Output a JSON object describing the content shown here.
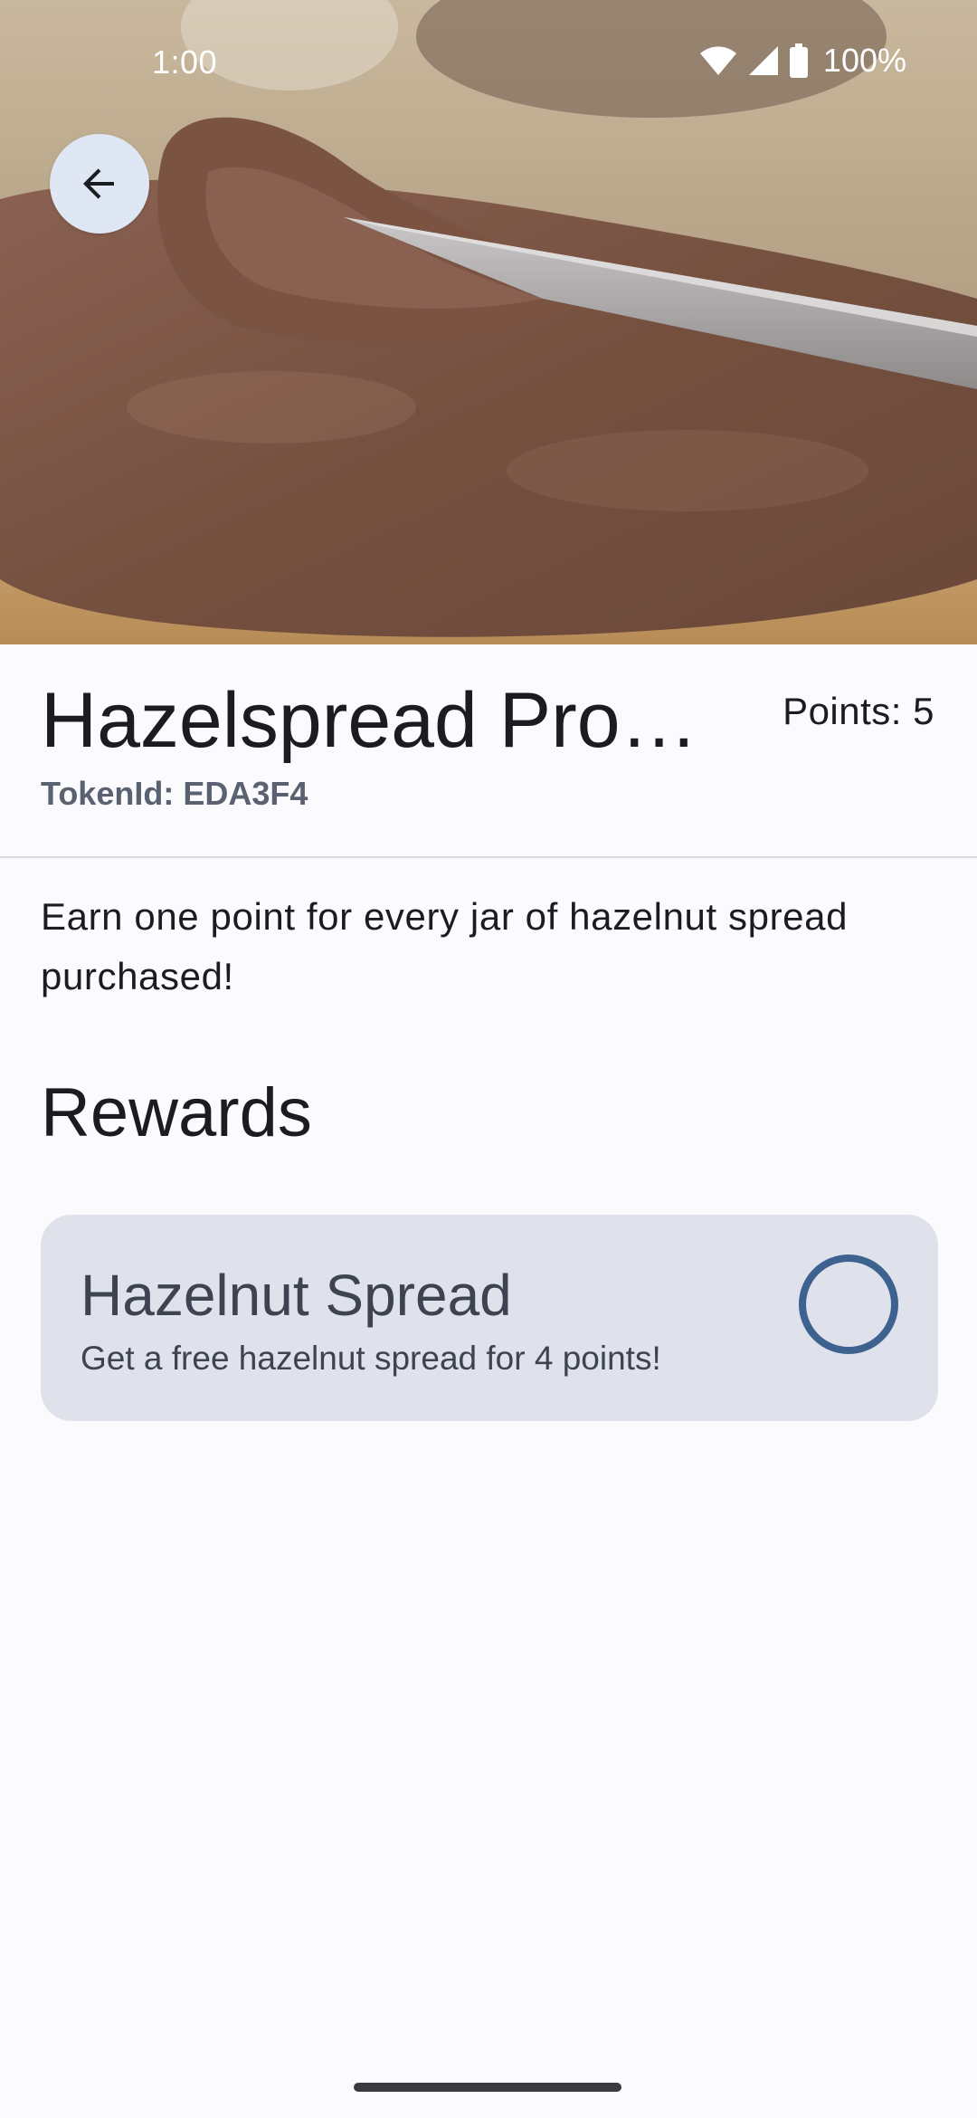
{
  "status_bar": {
    "time": "1:00",
    "battery": "100%"
  },
  "hero": {
    "image_description_icon": "hazelnut-spread-toast-photo"
  },
  "header": {
    "title": "Hazelspread Pro…",
    "points": "Points: 5",
    "token_id": "TokenId: EDA3F4"
  },
  "description": "Earn one point for every jar of hazelnut spread purchased!",
  "rewards": {
    "heading": "Rewards",
    "items": [
      {
        "title": "Hazelnut Spread",
        "description": "Get a free hazelnut spread for 4 points!",
        "selected": false
      }
    ]
  },
  "colors": {
    "background": "#fbfbfe",
    "card": "#dfe2ea",
    "accent": "#3d6290",
    "back_button_bg": "#dfe6f4"
  }
}
